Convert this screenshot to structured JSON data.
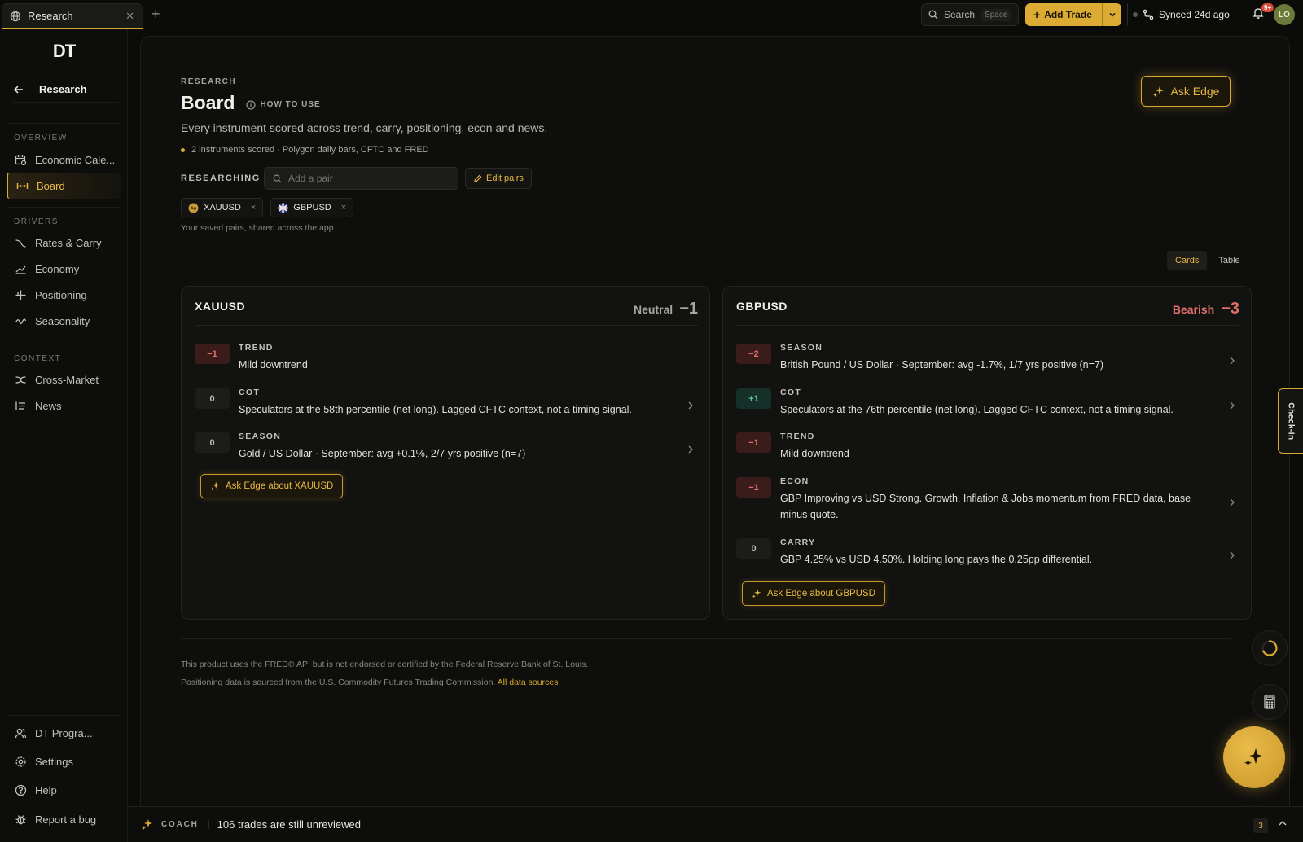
{
  "topbar": {
    "tab_label": "Research",
    "search_label": "Search",
    "search_shortcut": "Space",
    "add_trade_label": "Add Trade",
    "synced_label": "Synced 24d ago",
    "notif_badge": "9+",
    "avatar_initials": "LO"
  },
  "sidebar": {
    "logo": "DT",
    "back_label": "Research",
    "sections": {
      "overview": "OVERVIEW",
      "drivers": "DRIVERS",
      "context": "CONTEXT"
    },
    "items": {
      "economic_calendar": "Economic Cale...",
      "board": "Board",
      "rates_carry": "Rates & Carry",
      "economy": "Economy",
      "positioning": "Positioning",
      "seasonality": "Seasonality",
      "cross_market": "Cross-Market",
      "news": "News"
    },
    "bottom": {
      "program": "DT Progra...",
      "settings": "Settings",
      "help": "Help",
      "report_bug": "Report a bug"
    }
  },
  "header": {
    "eyebrow": "RESEARCH",
    "title": "Board",
    "how_to_use": "HOW TO USE",
    "subtitle": "Every instrument scored across trend, carry, positioning, econ and news.",
    "meta": "2 instruments scored · Polygon daily bars, CFTC and FRED",
    "ask_edge": "Ask Edge"
  },
  "researching": {
    "label": "RESEARCHING",
    "placeholder": "Add a pair",
    "edit_pairs": "Edit pairs",
    "chips": [
      {
        "label": "XAUUSD",
        "remove": "×"
      },
      {
        "label": "GBPUSD",
        "remove": "×"
      }
    ],
    "saved_note": "Your saved pairs, shared across the app"
  },
  "view_toggle": {
    "cards": "Cards",
    "table": "Table"
  },
  "cards": [
    {
      "symbol": "XAUUSD",
      "stance": "Neutral",
      "score": "−1",
      "factors": [
        {
          "score": "−1",
          "name": "TREND",
          "desc": "Mild downtrend"
        },
        {
          "score": "0",
          "name": "COT",
          "desc": "Speculators at the 58th percentile (net long). Lagged CFTC context, not a timing signal."
        },
        {
          "score": "0",
          "name": "SEASON",
          "desc": "Gold / US Dollar · September: avg +0.1%, 2/7 yrs positive (n=7)"
        }
      ],
      "ask_label": "Ask Edge about XAUUSD"
    },
    {
      "symbol": "GBPUSD",
      "stance": "Bearish",
      "score": "−3",
      "factors": [
        {
          "score": "−2",
          "name": "SEASON",
          "desc": "British Pound / US Dollar · September: avg -1.7%, 1/7 yrs positive (n=7)"
        },
        {
          "score": "+1",
          "name": "COT",
          "desc": "Speculators at the 76th percentile (net long). Lagged CFTC context, not a timing signal."
        },
        {
          "score": "−1",
          "name": "TREND",
          "desc": "Mild downtrend"
        },
        {
          "score": "−1",
          "name": "ECON",
          "desc": "GBP Improving vs USD Strong. Growth, Inflation & Jobs momentum from FRED data, base minus quote."
        },
        {
          "score": "0",
          "name": "CARRY",
          "desc": "GBP 4.25% vs USD 4.50%. Holding long pays the 0.25pp differential."
        }
      ],
      "ask_label": "Ask Edge about GBPUSD"
    }
  ],
  "footer": {
    "line1": "This product uses the FRED® API but is not endorsed or certified by the Federal Reserve Bank of St. Louis.",
    "line2": "Positioning data is sourced from the U.S. Commodity Futures Trading Commission.",
    "sources_link": "All data sources"
  },
  "right_rail": {
    "checkin": "Check-In"
  },
  "coach": {
    "label": "COACH",
    "message": "106 trades are still unreviewed",
    "count": "3"
  },
  "colors": {
    "accent": "#d9a931",
    "bearish": "#e07068",
    "bullish": "#5fc7a2",
    "background": "#0b0b0a"
  },
  "icons": [
    "globe-icon",
    "close-icon",
    "plus-icon",
    "search-icon",
    "chevron-down-icon",
    "sync-icon",
    "bell-icon",
    "arrow-left-icon",
    "calendar-icon",
    "board-icon",
    "rates-icon",
    "economy-icon",
    "positioning-icon",
    "seasonality-icon",
    "cross-market-icon",
    "news-icon",
    "user-icon",
    "gear-icon",
    "help-icon",
    "bug-icon",
    "info-icon",
    "pencil-icon",
    "sparkle-icon",
    "chevron-right-icon",
    "spinner-icon",
    "calculator-icon",
    "chevron-up-icon"
  ]
}
